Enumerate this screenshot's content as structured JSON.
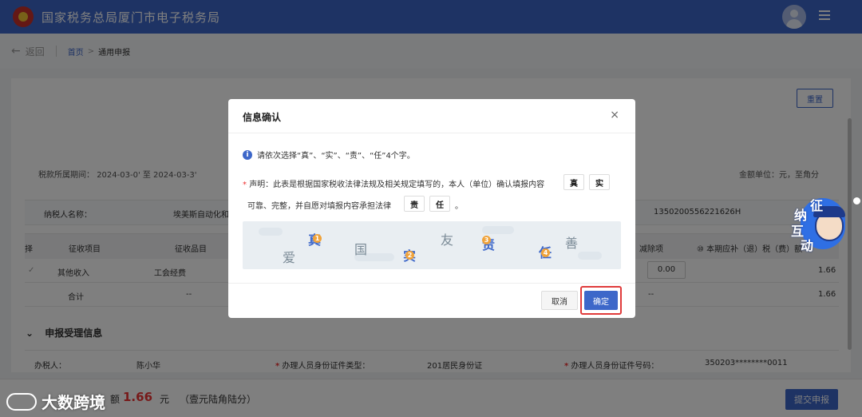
{
  "header": {
    "site_title": "国家税务总局厦门市电子税务局"
  },
  "breadcrumb": {
    "back": "返回",
    "home": "首页",
    "separator": ">",
    "current": "通用申报"
  },
  "toolbar": {
    "reset_label": "重置"
  },
  "form": {
    "period_label": "税款所属期间：",
    "period_value": "2024-03-0' 至 2024-03-3'",
    "unit_label": "金额单位：元，至角分",
    "taxpayer_label": "纳税人名称：",
    "taxpayer_value": "埃美斯自动化和",
    "taxpayer_id": "1350200556221626H"
  },
  "table": {
    "headers": [
      "择",
      "征收项目",
      "征收品目",
      "减除项",
      "⑩ 本期应补（退）税（费）额"
    ],
    "rows": [
      {
        "check": "✓",
        "item": "其他收入",
        "sub_item": "工会经费",
        "deduction": "0.00",
        "amount": "1.66"
      },
      {
        "label": "合计",
        "sub_item": "--",
        "deduction": "--",
        "amount": "1.66"
      }
    ]
  },
  "section": {
    "title": "申报受理信息",
    "handler_label": "办税人：",
    "handler_value": "陈小华",
    "id_type_label": "办理人员身份证件类型：",
    "id_type_value": "201居民身份证",
    "id_no_label": "办理人员身份证件号码：",
    "id_no_value": "350203********0011",
    "required_mark": "*"
  },
  "footer": {
    "total_label": "额",
    "total_amount": "1.66",
    "total_unit": "元",
    "total_words": "（壹元陆角陆分）",
    "submit_label": "提交申报"
  },
  "watermark": {
    "text": "大数跨境"
  },
  "mascot": {
    "chars": [
      "征",
      "纳",
      "互",
      "动"
    ]
  },
  "modal": {
    "title": "信息确认",
    "close": "×",
    "hint": "请依次选择“真”、“实”、“责”、“任”4个字。",
    "required_mark": "*",
    "declaration_line1": "声明：此表是根据国家税收法律法规及相关规定填写的，本人（单位）确认填报内容",
    "declaration_line2": "可靠、完整，并自愿对填报内容承担法律",
    "selected_chars": [
      "真",
      "实",
      "责",
      "任"
    ],
    "period": "。",
    "captcha": {
      "chars": [
        "真",
        "爱",
        "国",
        "实",
        "友",
        "责",
        "任",
        "善"
      ],
      "badges": [
        "1",
        "2",
        "3",
        "4"
      ]
    },
    "cancel_label": "取消",
    "confirm_label": "确定"
  },
  "colors": {
    "primary": "#3d67c9",
    "danger": "#e03b3b",
    "amount": "#e33333"
  }
}
